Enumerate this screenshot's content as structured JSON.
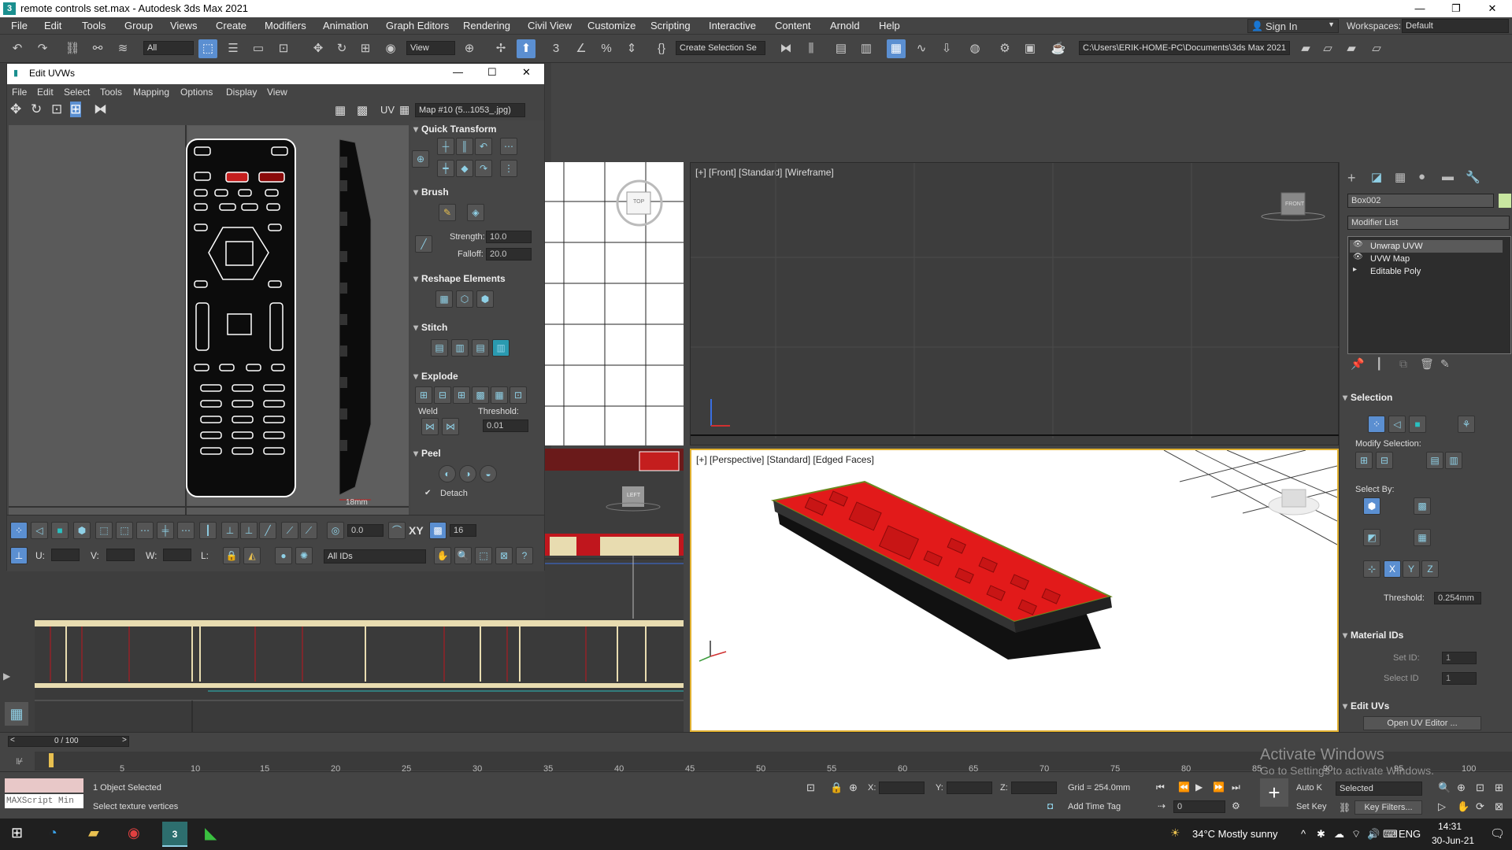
{
  "app": {
    "title": "remote controls set.max - Autodesk 3ds Max 2021"
  },
  "menus": [
    "File",
    "Edit",
    "Tools",
    "Group",
    "Views",
    "Create",
    "Modifiers",
    "Animation",
    "Graph Editors",
    "Rendering",
    "Civil View",
    "Customize",
    "Scripting",
    "Interactive",
    "Content",
    "Arnold",
    "Help"
  ],
  "user": {
    "signin": "Sign In",
    "workspaces_label": "Workspaces:",
    "workspace": "Default"
  },
  "toolbar": {
    "filter": "All",
    "refcoord": "View",
    "selection_set": "Create Selection Se",
    "project_path": "C:\\Users\\ERIK-HOME-PC\\Documents\\3ds Max 2021"
  },
  "uvw": {
    "title": "Edit UVWs",
    "menus": [
      "File",
      "Edit",
      "Select",
      "Tools",
      "Mapping",
      "Options",
      "Display",
      "View"
    ],
    "uv_label": "UV",
    "map": "Map #10 (5...1053_.jpg)",
    "dimension": "18mm",
    "sections": {
      "quick": "Quick Transform",
      "brush": "Brush",
      "reshape": "Reshape Elements",
      "stitch": "Stitch",
      "explode": "Explode",
      "peel": "Peel"
    },
    "strength_label": "Strength:",
    "strength": "10.0",
    "falloff_label": "Falloff:",
    "falloff": "20.0",
    "weld_label": "Weld",
    "threshold_label": "Threshold:",
    "threshold": "0.01",
    "detach_label": "Detach",
    "rot_value": "0.0",
    "xy_label": "XY",
    "grid_value": "16",
    "u_label": "U:",
    "v_label": "V:",
    "w_label": "W:",
    "l_label": "L:",
    "ids": "All IDs"
  },
  "viewports": {
    "front": "[+] [Front] [Standard] [Wireframe]",
    "persp": "[+] [Perspective] [Standard] [Edged Faces]",
    "front_cube": "FRONT",
    "top_cube": "TOP",
    "left_cube": "LEFT"
  },
  "command_panel": {
    "object_name": "Box002",
    "modifier_list": "Modifier List",
    "stack": [
      "Unwrap UVW",
      "UVW Map",
      "Editable Poly"
    ],
    "selection": "Selection",
    "modify_selection": "Modify Selection:",
    "select_by": "Select By:",
    "threshold_label": "Threshold:",
    "threshold": "0.254mm",
    "material_ids": "Material IDs",
    "set_id": "Set ID:",
    "select_id": "Select ID",
    "id_value": "1",
    "edit_uvs": "Edit UVs",
    "open_uv": "Open UV Editor ..."
  },
  "timeline": {
    "frame": "0 / 100",
    "ticks": [
      "5",
      "10",
      "15",
      "20",
      "25",
      "30",
      "35",
      "40",
      "45",
      "50",
      "55",
      "60",
      "65",
      "70",
      "75",
      "80",
      "85",
      "90",
      "95",
      "100"
    ]
  },
  "status": {
    "maxscript": "MAXScript Min",
    "selected": "1 Object Selected",
    "prompt": "Select texture vertices",
    "x": "X:",
    "y": "Y:",
    "z": "Z:",
    "grid": "Grid = 254.0mm",
    "add_time_tag": "Add Time Tag",
    "autokey": "Auto K",
    "setkey": "Set Key",
    "selected_dd": "Selected",
    "key_filters": "Key Filters...",
    "frame": "0"
  },
  "watermark": {
    "line1": "Activate Windows",
    "line2": "Go to Settings to activate Windows."
  },
  "taskbar": {
    "weather": "34°C  Mostly sunny",
    "lang": "ENG",
    "time": "14:31",
    "date": "30-Jun-21"
  }
}
